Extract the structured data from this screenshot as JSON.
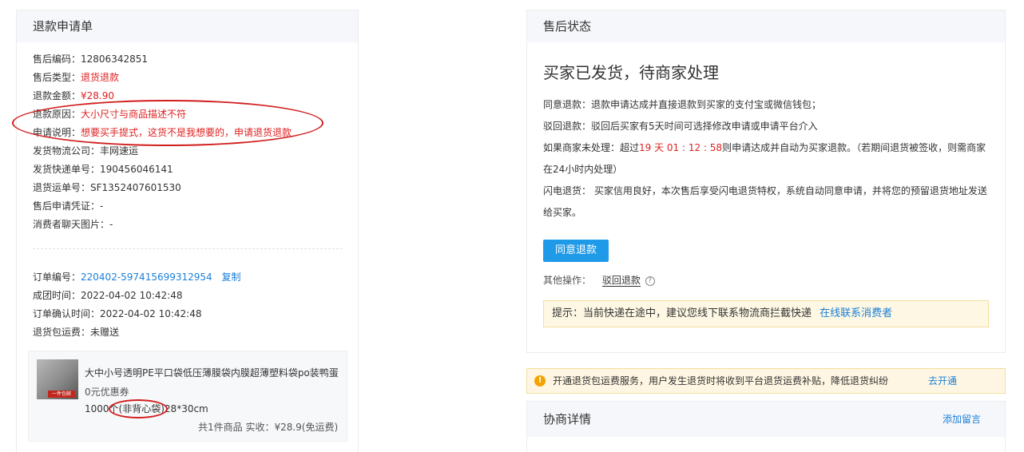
{
  "refund_form": {
    "title": "退款申请单",
    "fields": [
      {
        "label": "售后编码：",
        "value": "12806342851"
      },
      {
        "label": "售后类型：",
        "value": "退货退款"
      },
      {
        "label": "退款金额：",
        "value": "¥28.90"
      },
      {
        "label": "退款原因：",
        "value": "大小尺寸与商品描述不符"
      },
      {
        "label": "申请说明：",
        "value": "想要买手提式，这货不是我想要的，申请退货退款"
      },
      {
        "label": "发货物流公司：",
        "value": "丰网速运"
      },
      {
        "label": "发货快递单号：",
        "value": "190456046141"
      },
      {
        "label": "退货运单号：",
        "value": "SF1352407601530"
      },
      {
        "label": "售后申请凭证：",
        "value": "-"
      },
      {
        "label": "消费者聊天图片：",
        "value": "-"
      }
    ],
    "order_fields": [
      {
        "label": "订单编号：",
        "value": "220402-597415699312954"
      },
      {
        "label": "成团时间：",
        "value": "2022-04-02 10:42:48"
      },
      {
        "label": "订单确认时间：",
        "value": "2022-04-02 10:42:48"
      },
      {
        "label": "退货包运费：",
        "value": "未赠送"
      }
    ],
    "copy_label": "复制",
    "product": {
      "name": "大中小号透明PE平口袋低压薄膜袋内膜超薄塑料袋po装鸭蛋",
      "thumb_tag": "一件包邮",
      "coupon": "0元优惠券",
      "spec_prefix": "1000个",
      "spec_highlight": "(非背心袋)",
      "spec_suffix": "28*30cm",
      "summary": "共1件商品   实收：¥28.9(免运费)"
    }
  },
  "after_sale": {
    "title": "售后状态",
    "status": "买家已发货，待商家处理",
    "agree_line": "同意退款：退款申请达成并直接退款到买家的支付宝或微信钱包；",
    "reject_line": "驳回退款：驳回后买家有5天时间可选择修改申请或申请平台介入",
    "timeout_prefix": "如果商家未处理：超过",
    "timeout_countdown": "19 天 01 : 12 : 58",
    "timeout_suffix": "则申请达成并自动为买家退款。（若期间退货被签收，则需商家",
    "timeout_line2": "在24小时内处理）",
    "flash_line1": "闪电退货： 买家信用良好，本次售后享受闪电退货特权，系统自动同意申请，并将您的预留退货地址发送",
    "flash_line2": "给买家。",
    "agree_button": "同意退款",
    "other_ops_label": "其他操作：",
    "reject_link": "驳回退款",
    "help_icon": "?",
    "tip_text": "提示：当前快递在途中，建议您线下联系物流商拦截快递",
    "tip_link": "在线联系消费者"
  },
  "banner": {
    "warn_icon": "!",
    "text": "开通退货包运费服务，用户发生退货时将收到平台退货运费补贴，降低退货纠纷",
    "link": "去开通"
  },
  "negotiation": {
    "title": "协商详情",
    "add_message": "添加留言"
  },
  "colors": {
    "accent_red": "#e02020",
    "link_blue": "#1c7fd8",
    "button_blue": "#1f9ae8",
    "annotation_red": "#d21e1e"
  }
}
